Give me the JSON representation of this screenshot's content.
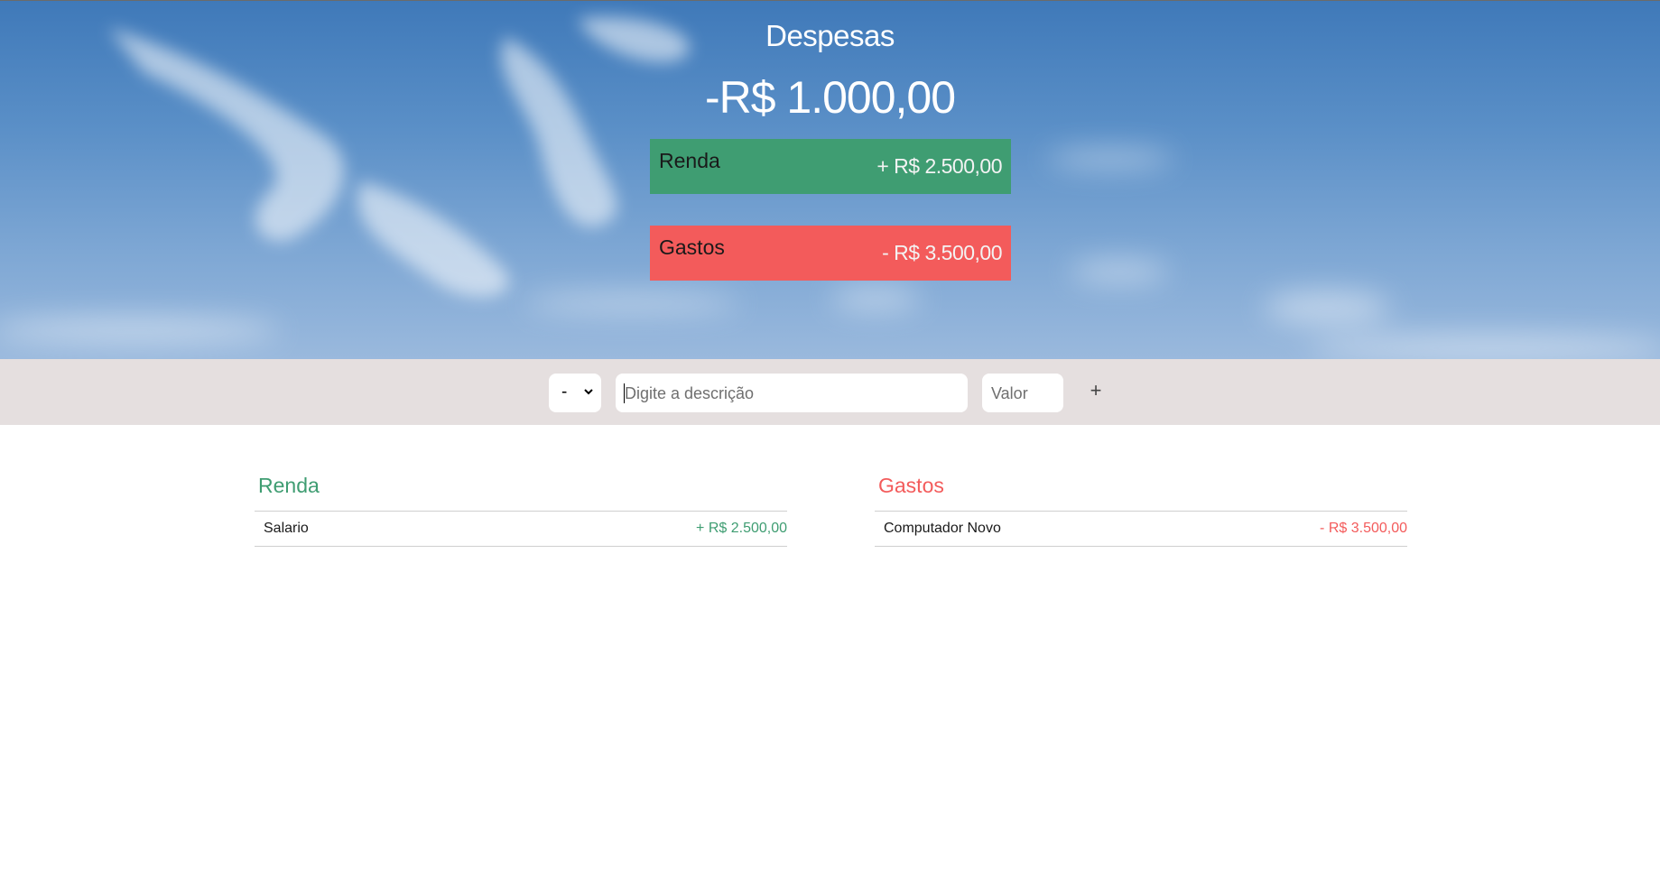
{
  "header": {
    "title": "Despesas",
    "balance": "-R$ 1.000,00"
  },
  "summary": {
    "income": {
      "label": "Renda",
      "value": "+ R$ 2.500,00",
      "color": "#3f9d72"
    },
    "expense": {
      "label": "Gastos",
      "value": "- R$ 3.500,00",
      "color": "#f35b5b"
    }
  },
  "form": {
    "type_selected": "-",
    "description_placeholder": "Digite a descrição",
    "value_placeholder": "Valor",
    "add_label": "+"
  },
  "lists": {
    "income": {
      "title": "Renda",
      "items": [
        {
          "description": "Salario",
          "value": "+ R$ 2.500,00"
        }
      ]
    },
    "expense": {
      "title": "Gastos",
      "items": [
        {
          "description": "Computador Novo",
          "value": "- R$ 3.500,00"
        }
      ]
    }
  },
  "icons": {
    "select_arrow": "chevron-down-icon"
  }
}
